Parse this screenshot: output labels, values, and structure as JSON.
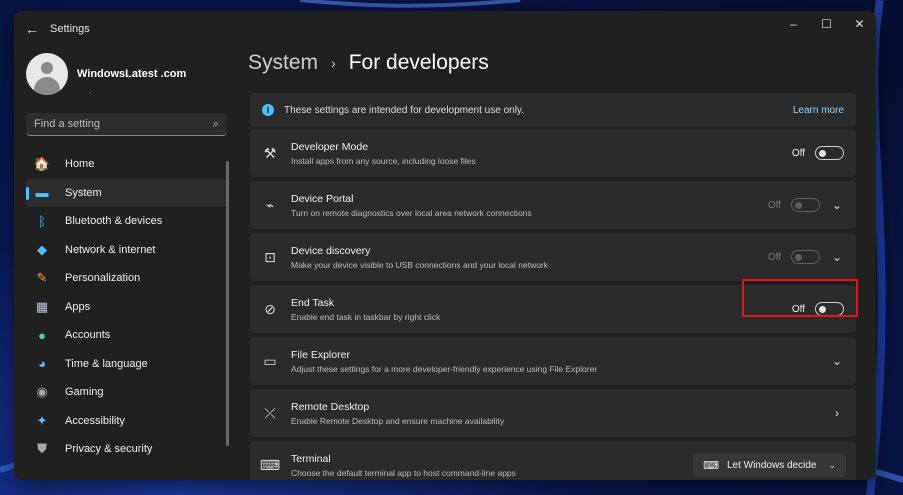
{
  "window": {
    "title": "Settings",
    "controls": {
      "minimize": "–",
      "maximize": "☐",
      "close": "✕"
    }
  },
  "profile": {
    "name": "WindowsLatest .com",
    "sub": "."
  },
  "search": {
    "placeholder": "Find a setting"
  },
  "sidebar": {
    "items": [
      {
        "label": "Home",
        "icon": "home-icon",
        "glyph": "🏠",
        "color": "#f0a45b"
      },
      {
        "label": "System",
        "icon": "system-icon",
        "glyph": "▬",
        "color": "#4cc2ff",
        "active": true
      },
      {
        "label": "Bluetooth & devices",
        "icon": "bluetooth-icon",
        "glyph": "ᛒ",
        "color": "#4cc2ff"
      },
      {
        "label": "Network & internet",
        "icon": "wifi-icon",
        "glyph": "◆",
        "color": "#5fb7ff"
      },
      {
        "label": "Personalization",
        "icon": "brush-icon",
        "glyph": "✎",
        "color": "#f4a340"
      },
      {
        "label": "Apps",
        "icon": "apps-icon",
        "glyph": "▦",
        "color": "#b8c7e8"
      },
      {
        "label": "Accounts",
        "icon": "accounts-icon",
        "glyph": "●",
        "color": "#3fd29c"
      },
      {
        "label": "Time & language",
        "icon": "globe-icon",
        "glyph": "◕",
        "color": "#5fb7ff"
      },
      {
        "label": "Gaming",
        "icon": "gamepad-icon",
        "glyph": "◉",
        "color": "#a8a8a8"
      },
      {
        "label": "Accessibility",
        "icon": "accessibility-icon",
        "glyph": "✦",
        "color": "#5fb7ff"
      },
      {
        "label": "Privacy & security",
        "icon": "shield-icon",
        "glyph": "⛊",
        "color": "#a8a8a8"
      }
    ]
  },
  "breadcrumb": {
    "parent": "System",
    "separator": "›",
    "current": "For developers"
  },
  "info_bar": {
    "text": "These settings are intended for development use only.",
    "link": "Learn more"
  },
  "cards": [
    {
      "id": "developer-mode",
      "icon": "developer-tools-icon",
      "glyph": "⚒",
      "title": "Developer Mode",
      "desc": "Install apps from any source, including loose files",
      "toggle": "Off",
      "disabled": false,
      "chevron": ""
    },
    {
      "id": "device-portal",
      "icon": "device-portal-icon",
      "glyph": "⌁",
      "title": "Device Portal",
      "desc": "Turn on remote diagnostics over local area network connections",
      "toggle": "Off",
      "disabled": true,
      "chevron": "⌄"
    },
    {
      "id": "device-discovery",
      "icon": "device-discovery-icon",
      "glyph": "⊡",
      "title": "Device discovery",
      "desc": "Make your device visible to USB connections and your local network",
      "toggle": "Off",
      "disabled": true,
      "chevron": "⌄"
    },
    {
      "id": "end-task",
      "icon": "end-task-icon",
      "glyph": "⊘",
      "title": "End Task",
      "desc": "Enable end task in taskbar by right click",
      "toggle": "Off",
      "disabled": false,
      "chevron": ""
    },
    {
      "id": "file-explorer",
      "icon": "folder-icon",
      "glyph": "▭",
      "title": "File Explorer",
      "desc": "Adjust these settings for a more developer-friendly experience using File Explorer",
      "toggle": "",
      "disabled": false,
      "chevron": "⌄"
    },
    {
      "id": "remote-desktop",
      "icon": "remote-desktop-icon",
      "glyph": "⤫",
      "title": "Remote Desktop",
      "desc": "Enable Remote Desktop and ensure machine availability",
      "toggle": "",
      "disabled": false,
      "chevron": "›"
    },
    {
      "id": "terminal",
      "icon": "terminal-icon",
      "glyph": "⌨",
      "title": "Terminal",
      "desc": "Choose the default terminal app to host command-line apps",
      "toggle": "",
      "disabled": false,
      "chevron": "",
      "dropdown": "Let Windows decide"
    }
  ],
  "colors": {
    "accent": "#4cc2ff",
    "highlight": "#e0161b",
    "card": "#2b2b2b",
    "window": "#202020"
  }
}
